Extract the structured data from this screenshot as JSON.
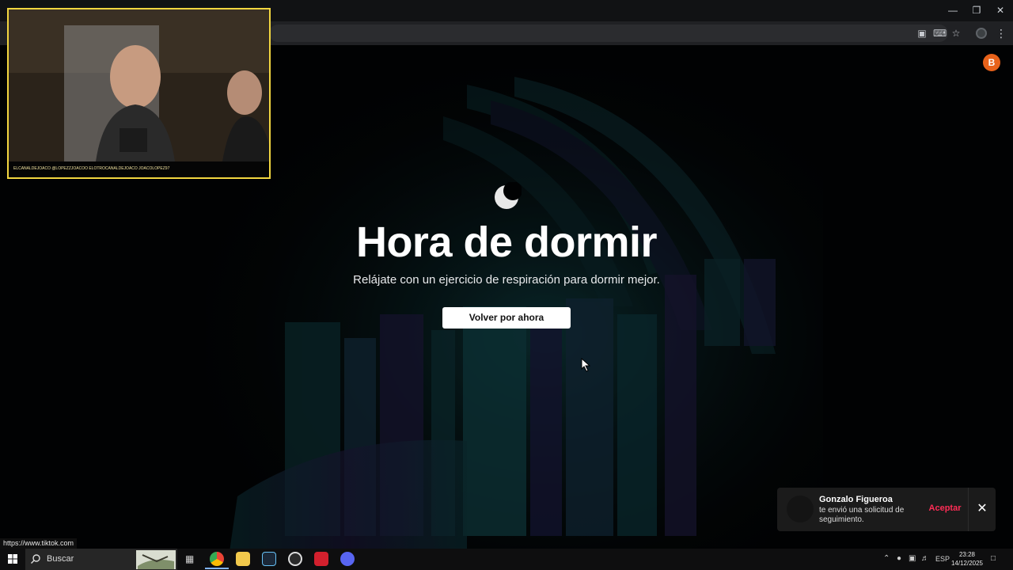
{
  "page": {
    "headline": "Hora de dormir",
    "subtitle": "Relájate con un ejercicio de respiración para dormir mejor.",
    "back_button": "Volver por ahora",
    "profile_initial": "B",
    "accent_color": "#e8621a"
  },
  "webcam": {
    "handles": "ELCANALDEJOACO  @LOPEZZJOACOO  ELOTROCANALDEJOACO  JOACOLOPEZ97"
  },
  "notification": {
    "name": "Gonzalo Figueroa",
    "message": "te envió una solicitud de seguimiento.",
    "accept_label": "Aceptar",
    "accept_color": "#fe2c55"
  },
  "status_bar": {
    "url": "https://www.tiktok.com"
  },
  "taskbar": {
    "search_label": "Buscar",
    "language": "ESP",
    "time": "23:28",
    "date": "14/12/2025"
  }
}
